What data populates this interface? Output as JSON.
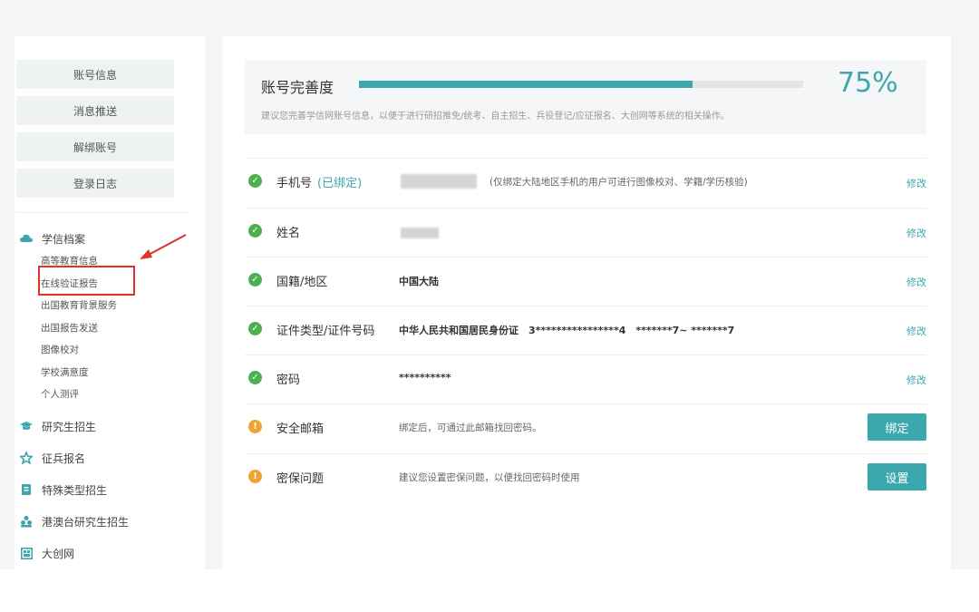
{
  "sidebar": {
    "buttons": [
      "账号信息",
      "消息推送",
      "解绑账号",
      "登录日志"
    ],
    "sections": [
      {
        "label": "学信档案",
        "icon": "cloud-icon"
      },
      {
        "label": "研究生招生",
        "icon": "graduation-cap-icon"
      },
      {
        "label": "征兵报名",
        "icon": "star-icon"
      },
      {
        "label": "特殊类型招生",
        "icon": "book-icon"
      },
      {
        "label": "港澳台研究生招生",
        "icon": "people-icon"
      },
      {
        "label": "大创网",
        "icon": "window-icon"
      }
    ],
    "subitems": [
      "高等教育信息",
      "在线验证报告",
      "出国教育背景服务",
      "出国报告发送",
      "图像校对",
      "学校满意度",
      "个人测评"
    ]
  },
  "progress": {
    "title": "账号完善度",
    "percent_text": "75%",
    "value": 0.75,
    "hint": "建议您完善学信网账号信息，以便于进行研招推免/统考、自主招生、兵役登记/应征报名、大创网等系统的相关操作。",
    "color": "#3ba8ae"
  },
  "rows": [
    {
      "label": "手机号",
      "tag": "(已绑定)",
      "value": "(仅绑定大陆地区手机的用户可进行图像校对、学籍/学历核验)",
      "action": "修改",
      "status": "ok"
    },
    {
      "label": "姓名",
      "value": "",
      "action": "修改",
      "status": "ok"
    },
    {
      "label": "国籍/地区",
      "value": "中国大陆",
      "action": "修改",
      "status": "ok"
    },
    {
      "label": "证件类型/证件号码",
      "value": "中华人民共和国居民身份证　3****************4　*******7~ *******7",
      "action": "修改",
      "status": "ok"
    },
    {
      "label": "密码",
      "value": "**********",
      "action": "修改",
      "status": "ok"
    },
    {
      "label": "安全邮箱",
      "value": "绑定后，可通过此邮箱找回密码。",
      "action": "绑定",
      "status": "warn"
    },
    {
      "label": "密保问题",
      "value": "建议您设置密保问题，以便找回密码时使用",
      "action": "设置",
      "status": "warn"
    }
  ]
}
